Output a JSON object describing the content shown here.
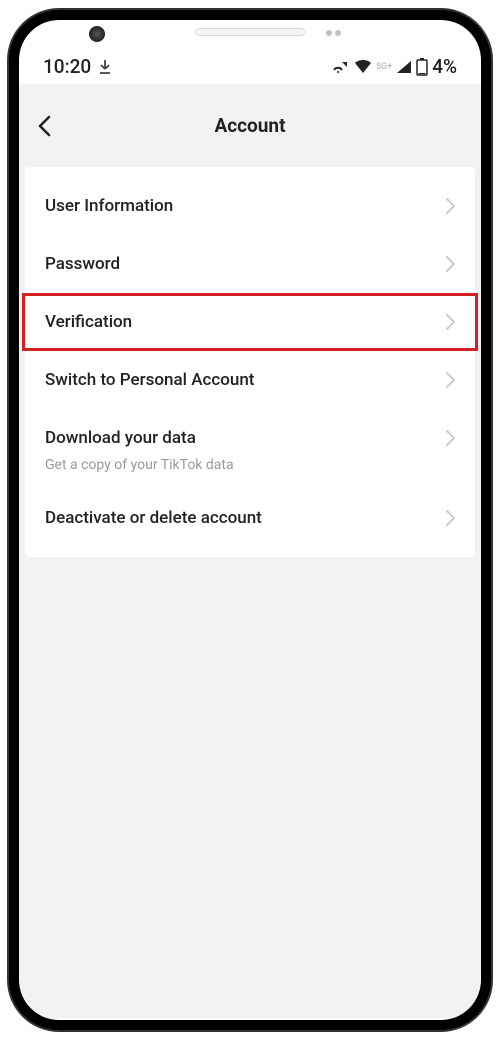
{
  "status_bar": {
    "time": "10:20",
    "network_label": "5G+",
    "battery": "4%"
  },
  "navbar": {
    "title": "Account"
  },
  "items": [
    {
      "label": "User Information",
      "highlighted": false,
      "subtitle": null
    },
    {
      "label": "Password",
      "highlighted": false,
      "subtitle": null
    },
    {
      "label": "Verification",
      "highlighted": true,
      "subtitle": null
    },
    {
      "label": "Switch to Personal Account",
      "highlighted": false,
      "subtitle": null
    },
    {
      "label": "Download your data",
      "highlighted": false,
      "subtitle": "Get a copy of your TikTok data"
    },
    {
      "label": "Deactivate or delete account",
      "highlighted": false,
      "subtitle": null
    }
  ]
}
